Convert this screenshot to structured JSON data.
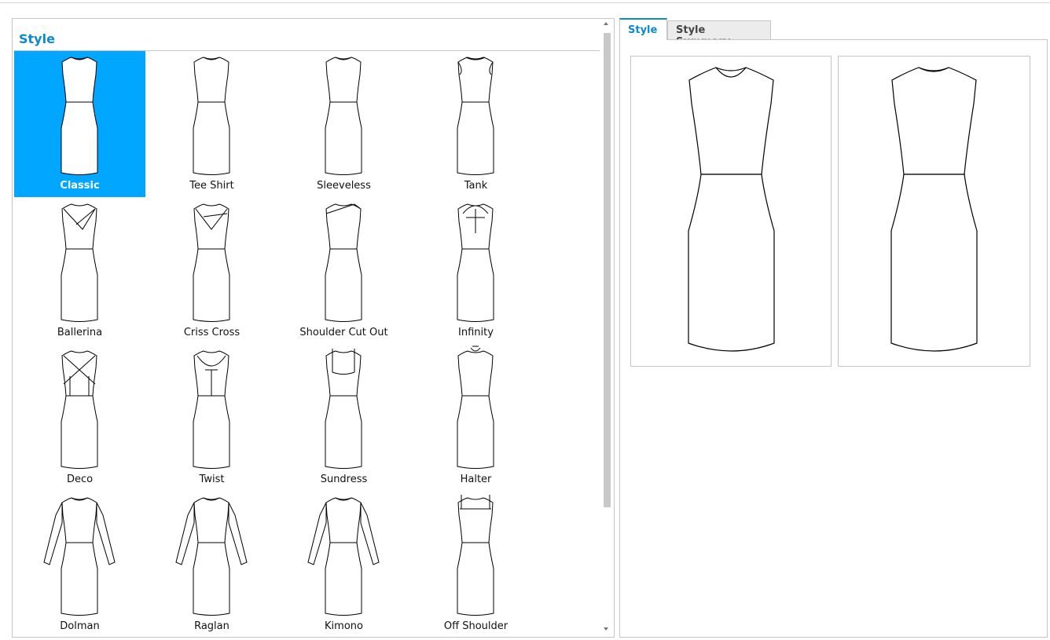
{
  "panel": {
    "title": "Style"
  },
  "styles": [
    {
      "label": "Classic",
      "selected": true,
      "icon": "classic-dress-icon"
    },
    {
      "label": "Tee Shirt",
      "selected": false,
      "icon": "tee-shirt-dress-icon"
    },
    {
      "label": "Sleeveless",
      "selected": false,
      "icon": "sleeveless-dress-icon"
    },
    {
      "label": "Tank",
      "selected": false,
      "icon": "tank-dress-icon"
    },
    {
      "label": "Ballerina",
      "selected": false,
      "icon": "ballerina-dress-icon"
    },
    {
      "label": "Criss Cross",
      "selected": false,
      "icon": "criss-cross-dress-icon"
    },
    {
      "label": "Shoulder Cut Out",
      "selected": false,
      "icon": "shoulder-cut-out-dress-icon"
    },
    {
      "label": "Infinity",
      "selected": false,
      "icon": "infinity-dress-icon"
    },
    {
      "label": "Deco",
      "selected": false,
      "icon": "deco-dress-icon"
    },
    {
      "label": "Twist",
      "selected": false,
      "icon": "twist-dress-icon"
    },
    {
      "label": "Sundress",
      "selected": false,
      "icon": "sundress-icon"
    },
    {
      "label": "Halter",
      "selected": false,
      "icon": "halter-dress-icon"
    },
    {
      "label": "Dolman",
      "selected": false,
      "icon": "dolman-dress-icon"
    },
    {
      "label": "Raglan",
      "selected": false,
      "icon": "raglan-dress-icon"
    },
    {
      "label": "Kimono",
      "selected": false,
      "icon": "kimono-dress-icon"
    },
    {
      "label": "Off Shoulder",
      "selected": false,
      "icon": "off-shoulder-dress-icon"
    }
  ],
  "tabs": [
    {
      "label": "Style",
      "active": true
    },
    {
      "label": "Style Summary",
      "active": false
    }
  ],
  "preview": {
    "front_icon": "dress-front-preview-icon",
    "back_icon": "dress-back-preview-icon"
  },
  "colors": {
    "accent": "#0a8ad0",
    "selected_bg": "#00a6ff",
    "border": "#c6c6c6"
  }
}
